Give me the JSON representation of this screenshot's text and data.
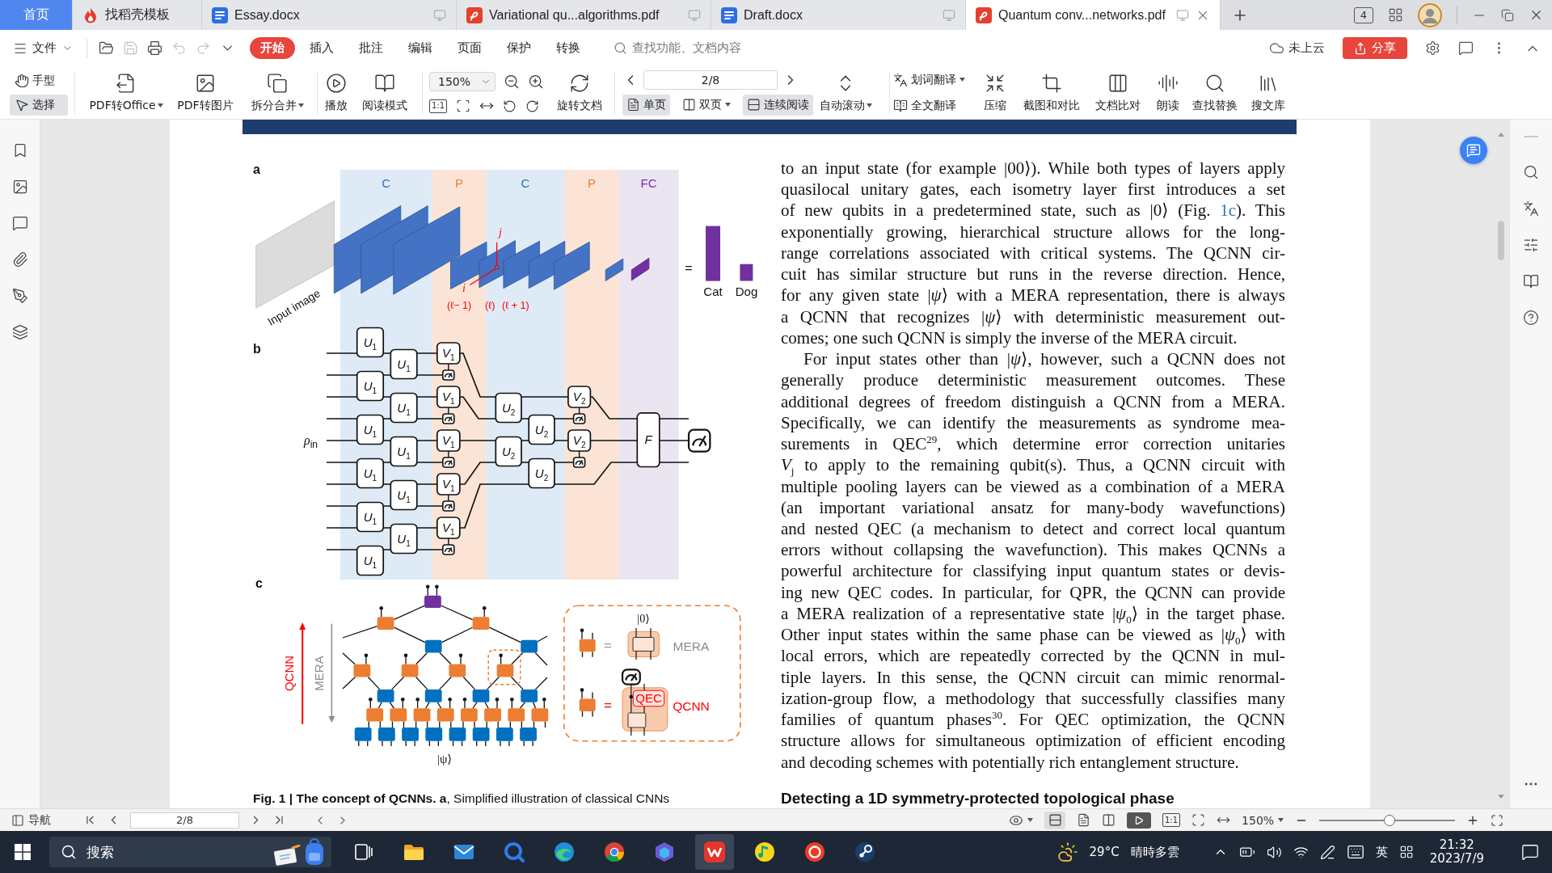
{
  "tabs": [
    {
      "label": "首页",
      "kind": "home",
      "selected": false
    },
    {
      "label": "找稻壳模板",
      "kind": "docer",
      "selected": false
    },
    {
      "label": "Essay.docx",
      "kind": "word",
      "selected": false
    },
    {
      "label": "Variational qu...algorithms.pdf",
      "kind": "pdf",
      "selected": false
    },
    {
      "label": "Draft.docx",
      "kind": "word",
      "selected": false
    },
    {
      "label": "Quantum conv...networks.pdf",
      "kind": "pdf",
      "selected": true
    }
  ],
  "window_controls": {
    "window_count": "4"
  },
  "menu": {
    "file": "文件",
    "quick_tools": [
      {
        "kind": "open",
        "disabled": false
      },
      {
        "kind": "save",
        "disabled": true
      },
      {
        "kind": "print",
        "disabled": false
      },
      {
        "kind": "undo",
        "disabled": true
      },
      {
        "kind": "redo",
        "disabled": true
      },
      {
        "kind": "customize",
        "disabled": false
      }
    ],
    "tabs": [
      {
        "label": "开始",
        "selected": true
      },
      {
        "label": "插入",
        "selected": false
      },
      {
        "label": "批注",
        "selected": false
      },
      {
        "label": "编辑",
        "selected": false
      },
      {
        "label": "页面",
        "selected": false
      },
      {
        "label": "保护",
        "selected": false
      },
      {
        "label": "转换",
        "selected": false
      }
    ],
    "search": {
      "placeholder": "查找功能、文档内容"
    },
    "cloud": "未上云",
    "share": "分享"
  },
  "toolbar": {
    "modes": [
      {
        "label": "手型",
        "kind": "hand",
        "selected": false
      },
      {
        "label": "选择",
        "kind": "select",
        "selected": true
      }
    ],
    "convert": [
      {
        "label": "PDF转Office",
        "kind": "office",
        "menu": true
      },
      {
        "label": "PDF转图片",
        "kind": "image",
        "menu": false
      },
      {
        "label": "拆分合并",
        "kind": "split",
        "menu": true
      }
    ],
    "view": [
      {
        "label": "播放",
        "kind": "play"
      },
      {
        "label": "阅读模式",
        "kind": "read"
      }
    ],
    "zoom": "150%",
    "actual_size": "1:1",
    "rotate": "旋转文档",
    "page": "2/8",
    "layouts": [
      {
        "label": "单页",
        "kind": "single",
        "selected": true,
        "menu": false
      },
      {
        "label": "双页",
        "kind": "double",
        "selected": false,
        "menu": true
      },
      {
        "label": "连续阅读",
        "kind": "continuous",
        "selected": true,
        "menu": false
      }
    ],
    "autoscroll": {
      "label": "自动滚动",
      "menu": true
    },
    "translate": [
      {
        "label": "划词翻译",
        "kind": "word",
        "menu": true
      },
      {
        "label": "全文翻译",
        "kind": "full",
        "menu": false
      }
    ],
    "tools": [
      {
        "label": "压缩",
        "kind": "compress"
      },
      {
        "label": "截图和对比",
        "kind": "screenshot"
      },
      {
        "label": "文档比对",
        "kind": "compare"
      },
      {
        "label": "朗读",
        "kind": "read-aloud"
      },
      {
        "label": "查找替换",
        "kind": "find"
      },
      {
        "label": "搜文库",
        "kind": "library"
      }
    ]
  },
  "document": {
    "figure": {
      "panel_a": {
        "label": "a",
        "columns": [
          {
            "label": "C",
            "kind": "conv"
          },
          {
            "label": "P",
            "kind": "pool"
          },
          {
            "label": "C",
            "kind": "conv"
          },
          {
            "label": "P",
            "kind": "pool"
          },
          {
            "label": "FC",
            "kind": "fc"
          }
        ],
        "input_label": "Input image",
        "axes": [
          "j",
          "i"
        ],
        "layers": [
          "(ℓ− 1)",
          "(ℓ)",
          "(ℓ + 1)"
        ],
        "equals": "=",
        "classes": [
          "Cat",
          "Dog"
        ]
      },
      "panel_b": {
        "label": "b",
        "input": {
          "symbol": "ρ",
          "index": "in"
        },
        "layers": [
          {
            "kind": "conv",
            "gates": [
              {
                "symbol": "U",
                "index": "1"
              },
              {
                "symbol": "U",
                "index": "1"
              },
              {
                "symbol": "U",
                "index": "1"
              },
              {
                "symbol": "U",
                "index": "1"
              },
              {
                "symbol": "U",
                "index": "1"
              },
              {
                "symbol": "U",
                "index": "1"
              },
              {
                "symbol": "U",
                "index": "1"
              },
              {
                "symbol": "U",
                "index": "1"
              },
              {
                "symbol": "U",
                "index": "1"
              },
              {
                "symbol": "U",
                "index": "1"
              },
              {
                "symbol": "U",
                "index": "1"
              }
            ]
          },
          {
            "kind": "pool",
            "gates": [
              {
                "symbol": "V",
                "index": "1"
              },
              {
                "symbol": "V",
                "index": "1"
              },
              {
                "symbol": "V",
                "index": "1"
              },
              {
                "symbol": "V",
                "index": "1"
              },
              {
                "symbol": "V",
                "index": "1"
              }
            ]
          },
          {
            "kind": "conv",
            "gates": [
              {
                "symbol": "U",
                "index": "2"
              },
              {
                "symbol": "U",
                "index": "2"
              },
              {
                "symbol": "U",
                "index": "2"
              },
              {
                "symbol": "U",
                "index": "2"
              }
            ]
          },
          {
            "kind": "pool",
            "gates": [
              {
                "symbol": "V",
                "index": "2"
              },
              {
                "symbol": "V",
                "index": "2"
              }
            ]
          },
          {
            "kind": "fc",
            "gates": [
              {
                "symbol": "F"
              }
            ]
          }
        ]
      },
      "panel_c": {
        "label": "c",
        "arrows": [
          {
            "label": "QCNN",
            "kind": "up"
          },
          {
            "label": "MERA",
            "kind": "down"
          }
        ],
        "state": "|ψ⟩",
        "legend": {
          "ket": "|0⟩",
          "rows": [
            {
              "kind": "mera",
              "equals": "=",
              "label": "MERA"
            },
            {
              "kind": "qcnn",
              "equals": "=",
              "label": "QCNN",
              "tag": "QEC"
            }
          ]
        }
      }
    },
    "paragraphs": [
      {
        "indent": false,
        "lines": [
          {
            "text": "to an input state (for example |00⟩). While both types of layers apply"
          },
          {
            "text": "quasilocal unitary gates, each isometry layer first introduces a set"
          },
          {
            "text": "of new qubits in a predetermined state, such as |0⟩ (Fig. ",
            "link": "1c",
            "after": "). This"
          },
          {
            "text": "exponentially growing, hierarchical structure allows for the long-"
          },
          {
            "text": "range correlations associated with critical systems. The QCNN cir-"
          },
          {
            "text": "cuit has similar structure but runs in the reverse direction. Hence,"
          },
          {
            "text": "for any given state |*ψ*⟩ with a MERA representation, there is always"
          },
          {
            "text": "a QCNN that recognizes |*ψ*⟩ with deterministic measurement out-"
          },
          {
            "text": "comes; one such QCNN is simply the inverse of the MERA circuit."
          }
        ]
      },
      {
        "indent": true,
        "lines": [
          {
            "text": "For input states other than |*ψ*⟩, however, such a QCNN does not"
          },
          {
            "text": "generally produce deterministic measurement outcomes. These"
          },
          {
            "text": "additional degrees of freedom distinguish a QCNN from a MERA."
          },
          {
            "text": "Specifically, we can identify the measurements as syndrome mea-"
          },
          {
            "text": "surements in QEC$^{29}$, which determine error correction unitaries"
          },
          {
            "text": "*V*$_{j}$ to apply to the remaining qubit(s). Thus, a QCNN circuit with"
          },
          {
            "text": "multiple pooling layers can be viewed as a combination of a MERA"
          },
          {
            "text": "(an important variational ansatz for many-body wavefunctions)"
          },
          {
            "text": "and nested QEC (a mechanism to detect and correct local quantum"
          },
          {
            "text": "errors without collapsing the wavefunction). This makes QCNNs a"
          },
          {
            "text": "powerful architecture for classifying input quantum states or devis-"
          },
          {
            "text": "ing new QEC codes. In particular, for QPR, the QCNN can provide"
          },
          {
            "text": "a MERA realization of a representative state |*ψ*$_{0}$⟩ in the target phase."
          },
          {
            "text": "Other input states within the same phase can be viewed as |*ψ*$_{0}$⟩ with"
          },
          {
            "text": "local errors, which are repeatedly corrected by the QCNN in mul-"
          },
          {
            "text": "tiple layers. In this sense, the QCNN circuit can mimic renormal-"
          },
          {
            "text": "ization-group flow, a methodology that successfully classifies many"
          },
          {
            "text": "families of quantum phases$^{30}$. For QEC optimization, the QCNN"
          },
          {
            "text": "structure allows for simultaneous optimization of efficient encoding"
          },
          {
            "text": "and decoding schemes with potentially rich entanglement structure."
          }
        ]
      }
    ],
    "caption": "**Fig. 1 | The concept of QCNNs. a**, Simplified illustration of classical CNNs",
    "heading": "Detecting a 1D symmetry-protected topological phase"
  },
  "status_bar": {
    "navigation": "导航",
    "page": "2/8",
    "actual_size": "1:1",
    "zoom": "150%",
    "zoom_slider": {
      "level": 0.52
    }
  },
  "taskbar": {
    "search": "搜索",
    "apps": [
      {
        "kind": "folder",
        "selected": false
      },
      {
        "kind": "envelope",
        "selected": false
      },
      {
        "kind": "ring",
        "selected": false
      },
      {
        "kind": "wave",
        "selected": false
      },
      {
        "kind": "wheel",
        "selected": false
      },
      {
        "kind": "hexagon",
        "selected": false
      },
      {
        "kind": "zigzag",
        "selected": true
      },
      {
        "kind": "disc",
        "selected": false
      },
      {
        "kind": "badge",
        "selected": false
      },
      {
        "kind": "piston",
        "selected": false
      }
    ],
    "weather": {
      "temperature": "29°C",
      "condition": "晴時多雲"
    },
    "input_mode": "英",
    "time": "21:32",
    "date": "2023/7/9"
  }
}
